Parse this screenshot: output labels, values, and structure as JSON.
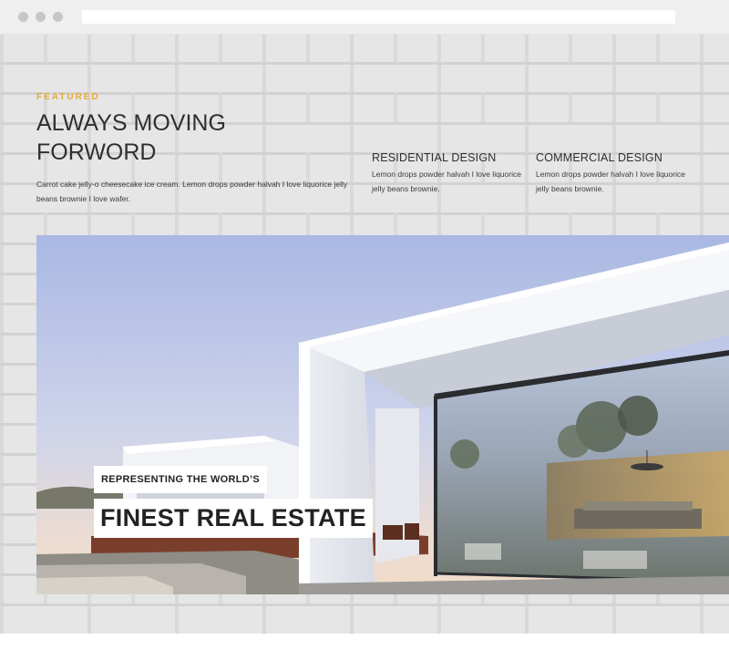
{
  "browser": {
    "url": ""
  },
  "featured": {
    "eyebrow": "FEATURED",
    "title_line1": "ALWAYS MOVING",
    "title_line2": "FORWORD",
    "description": "Carrot cake jelly-o cheesecake ice cream. Lemon drops powder halvah I love liquorice jelly beans brownie I love wafer."
  },
  "services": [
    {
      "title": "RESIDENTIAL DESIGN",
      "text": "Lemon drops powder halvah I love liquorice jelly beans brownie."
    },
    {
      "title": "COMMERCIAL DESIGN",
      "text": "Lemon drops powder halvah I love liquorice jelly beans brownie."
    }
  ],
  "hero": {
    "subtitle": "REPRESENTING THE WORLD’S",
    "title": "FINEST REAL ESTATE"
  },
  "colors": {
    "accent": "#e8a93a",
    "text_dark": "#2f2f2f",
    "wall": "#e6e6e6"
  }
}
